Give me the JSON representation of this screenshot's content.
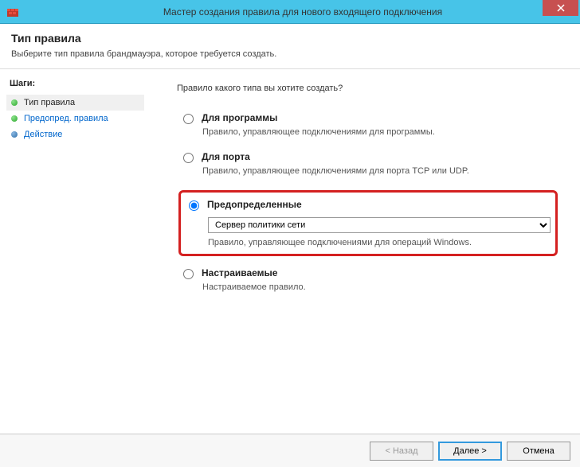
{
  "window": {
    "title": "Мастер создания правила для нового входящего подключения"
  },
  "header": {
    "title": "Тип правила",
    "subtitle": "Выберите тип правила брандмауэра, которое требуется создать."
  },
  "sidebar": {
    "heading": "Шаги:",
    "steps": [
      {
        "label": "Тип правила"
      },
      {
        "label": "Предопред. правила"
      },
      {
        "label": "Действие"
      }
    ]
  },
  "main": {
    "prompt": "Правило какого типа вы хотите создать?",
    "options": {
      "program": {
        "label": "Для программы",
        "desc": "Правило, управляющее подключениями для программы."
      },
      "port": {
        "label": "Для порта",
        "desc": "Правило, управляющее подключениями для порта TCP или UDP."
      },
      "predefined": {
        "label": "Предопределенные",
        "select_value": "Сервер политики сети",
        "desc": "Правило, управляющее подключениями для операций Windows."
      },
      "custom": {
        "label": "Настраиваемые",
        "desc": "Настраиваемое правило."
      }
    }
  },
  "footer": {
    "back": "< Назад",
    "next": "Далее >",
    "cancel": "Отмена"
  }
}
